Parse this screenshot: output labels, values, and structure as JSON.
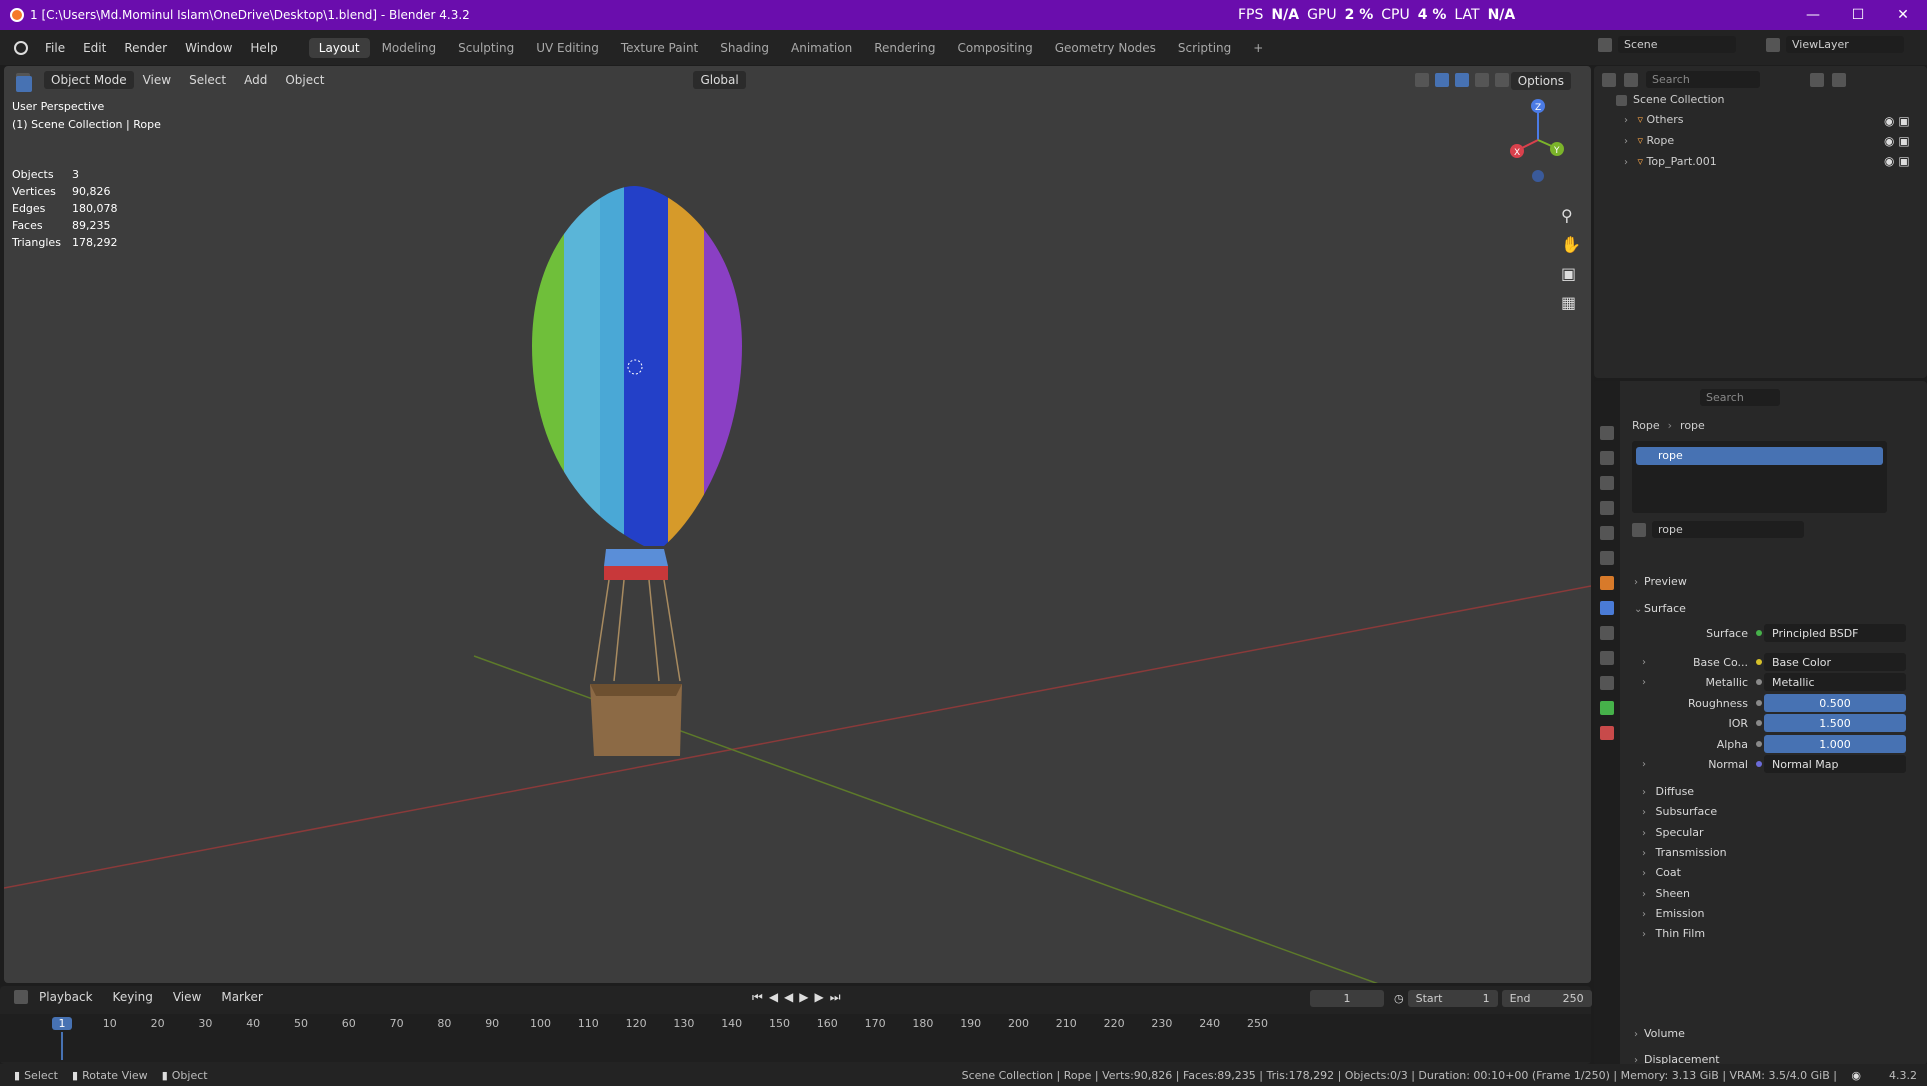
{
  "window": {
    "title": "1 [C:\\Users\\Md.Mominul Islam\\OneDrive\\Desktop\\1.blend] - Blender 4.3.2",
    "perf": {
      "fps_label": "FPS",
      "fps": "N/A",
      "gpu_label": "GPU",
      "gpu": "2 %",
      "cpu_label": "CPU",
      "cpu": "4 %",
      "lat_label": "LAT",
      "lat": "N/A"
    }
  },
  "menu": [
    "File",
    "Edit",
    "Render",
    "Window",
    "Help"
  ],
  "workspaces": [
    "Layout",
    "Modeling",
    "Sculpting",
    "UV Editing",
    "Texture Paint",
    "Shading",
    "Animation",
    "Rendering",
    "Compositing",
    "Geometry Nodes",
    "Scripting"
  ],
  "scene": {
    "name": "Scene",
    "view_layer": "ViewLayer"
  },
  "viewport": {
    "mode": "Object Mode",
    "menus": [
      "View",
      "Select",
      "Add",
      "Object"
    ],
    "transform": "Global",
    "options": "Options",
    "perspective": "User Perspective",
    "collection_label": "(1) Scene Collection | Rope",
    "stats": [
      {
        "label": "Objects",
        "value": "3"
      },
      {
        "label": "Vertices",
        "value": "90,826"
      },
      {
        "label": "Edges",
        "value": "180,078"
      },
      {
        "label": "Faces",
        "value": "89,235"
      },
      {
        "label": "Triangles",
        "value": "178,292"
      }
    ],
    "gizmo": {
      "z": "Z",
      "x": "X",
      "y": "Y"
    }
  },
  "outliner": {
    "search": "Search",
    "root": "Scene Collection",
    "items": [
      "Others",
      "Rope",
      "Top_Part.001"
    ]
  },
  "properties": {
    "search": "Search",
    "breadcrumb_object": "Rope",
    "breadcrumb_material": "rope",
    "slot": "rope",
    "material_name": "rope",
    "sections": {
      "preview": "Preview",
      "surface": "Surface"
    },
    "rows": [
      {
        "label": "Surface",
        "value": "Principled BSDF",
        "type": "link",
        "dot": "#46b14a"
      },
      {
        "label": "Base Co...",
        "value": "Base Color",
        "type": "link",
        "dot": "#d6c12a",
        "expand": true
      },
      {
        "label": "Metallic",
        "value": "Metallic",
        "type": "link",
        "dot": "#8a8a8a",
        "expand": true
      },
      {
        "label": "Roughness",
        "value": "0.500",
        "type": "num",
        "dot": "#8a8a8a"
      },
      {
        "label": "IOR",
        "value": "1.500",
        "type": "num",
        "dot": "#8a8a8a"
      },
      {
        "label": "Alpha",
        "value": "1.000",
        "type": "num",
        "dot": "#8a8a8a"
      },
      {
        "label": "Normal",
        "value": "Normal Map",
        "type": "link",
        "dot": "#6b6bd8",
        "expand": true
      }
    ],
    "subpanels": [
      "Diffuse",
      "Subsurface",
      "Specular",
      "Transmission",
      "Coat",
      "Sheen",
      "Emission",
      "Thin Film"
    ],
    "bottom": [
      "Volume",
      "Displacement"
    ]
  },
  "timeline": {
    "menus": [
      "Playback",
      "Keying",
      "View",
      "Marker"
    ],
    "current_frame": "1",
    "start_label": "Start",
    "start": "1",
    "end_label": "End",
    "end": "250",
    "ticks": [
      "1",
      "10",
      "20",
      "30",
      "40",
      "50",
      "60",
      "70",
      "80",
      "90",
      "100",
      "110",
      "120",
      "130",
      "140",
      "150",
      "160",
      "170",
      "180",
      "190",
      "200",
      "210",
      "220",
      "230",
      "240",
      "250"
    ]
  },
  "statusbar": {
    "left": [
      "Select",
      "Rotate View",
      "Object"
    ],
    "right": "Scene Collection | Rope | Verts:90,826 | Faces:89,235 | Tris:178,292 | Objects:0/3 | Duration: 00:10+00 (Frame 1/250) | Memory: 3.13 GiB | VRAM: 3.5/4.0 GiB |",
    "version": "4.3.2"
  }
}
